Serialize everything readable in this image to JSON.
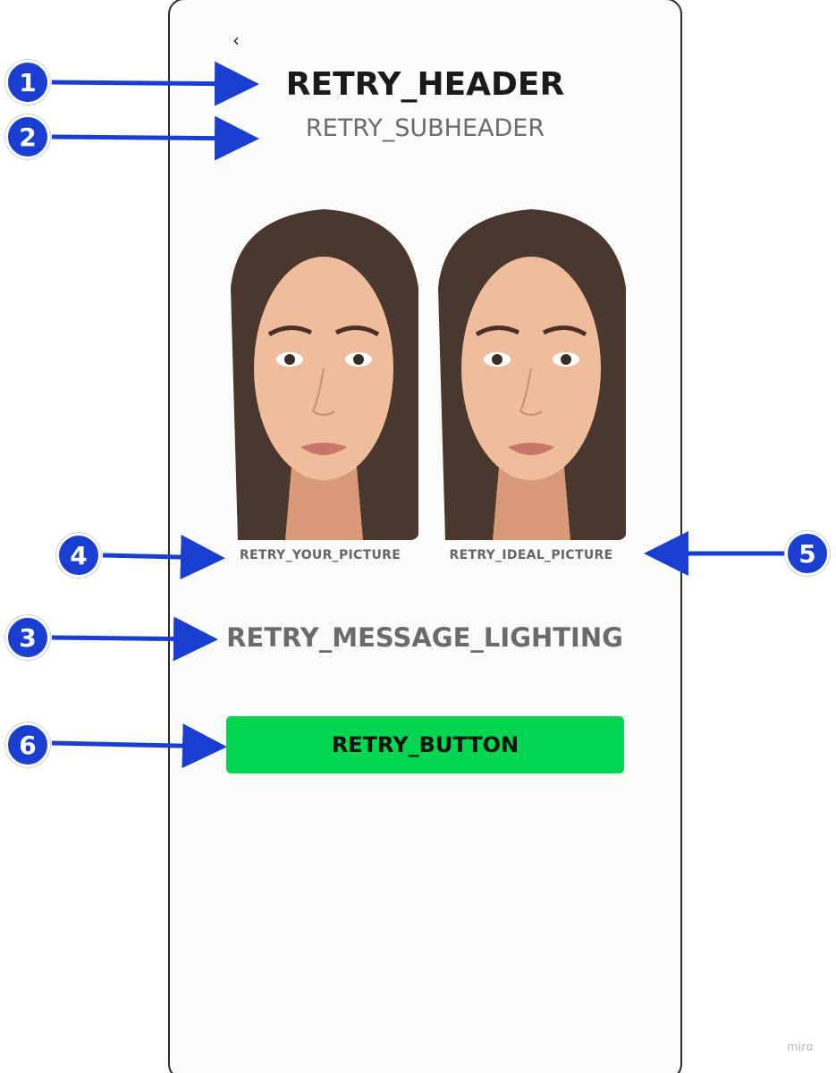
{
  "screen": {
    "back_icon": "chevron-left-icon",
    "back_glyph": "‹",
    "header": "RETRY_HEADER",
    "subheader": "RETRY_SUBHEADER",
    "your_picture_label": "RETRY_YOUR_PICTURE",
    "ideal_picture_label": "RETRY_IDEAL_PICTURE",
    "message": "RETRY_MESSAGE_LIGHTING",
    "button_label": "RETRY_BUTTON"
  },
  "annotations": [
    {
      "number": "1",
      "target": "header"
    },
    {
      "number": "2",
      "target": "subheader"
    },
    {
      "number": "3",
      "target": "message"
    },
    {
      "number": "4",
      "target": "your_picture_label"
    },
    {
      "number": "5",
      "target": "ideal_picture_label"
    },
    {
      "number": "6",
      "target": "button_label"
    }
  ],
  "watermark": "miro",
  "colors": {
    "button": "#00d64f",
    "annotation_blue": "#1a3fd0",
    "background": "#fbfcfa"
  }
}
